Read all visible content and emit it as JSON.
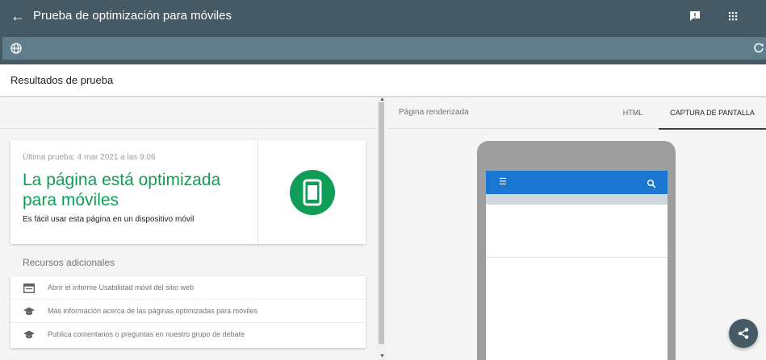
{
  "header": {
    "title": "Prueba de optimización para móviles",
    "back_icon": "arrow-back-icon",
    "feedback_icon": "feedback-icon",
    "apps_icon": "apps-grid-icon"
  },
  "url_bar": {
    "value": "",
    "globe_icon": "globe-icon",
    "reload_icon": "reload-icon"
  },
  "results": {
    "title": "Resultados de prueba"
  },
  "result_card": {
    "last_test": "Última prueba: 4 mar 2021 a las 9:06",
    "headline": "La página está optimizada para móviles",
    "description": "Es fácil usar esta página en un dispositivo móvil",
    "badge_icon": "mobile-phone-icon",
    "accent_color": "#0f9d58"
  },
  "resources": {
    "title": "Recursos adicionales",
    "items": [
      {
        "icon": "report-icon",
        "label": "Abrir el informe Usabilidad móvil del sitio web"
      },
      {
        "icon": "school-icon",
        "label": "Más información acerca de las páginas optimizadas para móviles"
      },
      {
        "icon": "school-icon",
        "label": "Publica comentarios o preguntas en nuestro grupo de debate"
      }
    ]
  },
  "preview": {
    "rendered_label": "Página renderizada",
    "tabs": [
      {
        "label": "HTML",
        "active": false
      },
      {
        "label": "CAPTURA DE PANTALLA",
        "active": true
      }
    ],
    "app_bar_color": "#1976d2",
    "menu_icon": "hamburger-menu-icon",
    "search_icon": "search-icon"
  },
  "fab": {
    "icon": "share-icon"
  },
  "colors": {
    "header": "#455a64",
    "url_bar": "#607d8b"
  }
}
